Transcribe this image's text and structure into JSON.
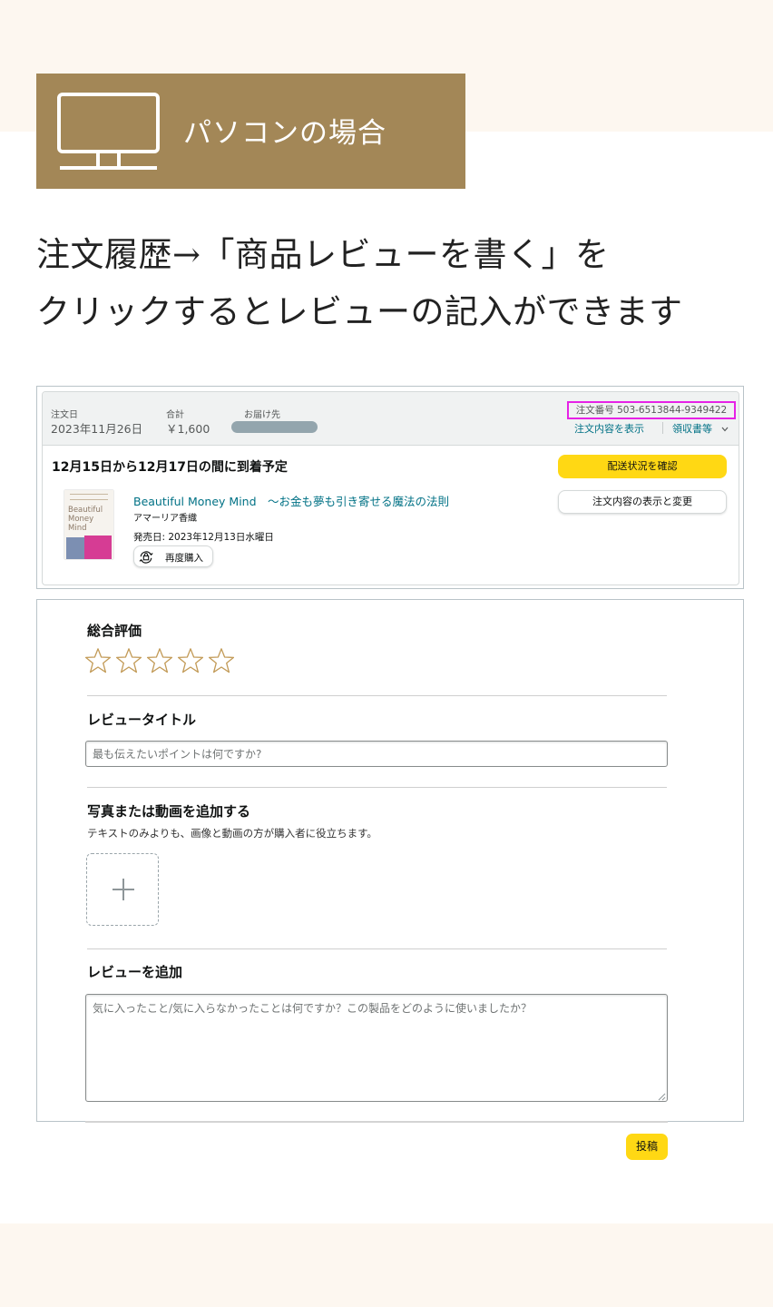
{
  "banner": {
    "label": "パソコンの場合"
  },
  "headline": {
    "line1": "注文履歴→「商品レビューを書く」を",
    "line2": "クリックするとレビューの記入ができます"
  },
  "order": {
    "date_label": "注文日",
    "date_value": "2023年11月26日",
    "total_label": "合計",
    "total_value": "￥1,600",
    "ship_label": "お届け先",
    "order_number": "注文番号 503-6513844-9349422",
    "view_details_link": "注文内容を表示",
    "receipt_link": "領収書等",
    "arrival": "12月15日から12月17日の間に到着予定",
    "track_button": "配送状況を確認",
    "change_button": "注文内容の表示と変更",
    "product_title": "Beautiful Money Mind　〜お金も夢も引き寄せる魔法の法則",
    "author": "アマーリア香織",
    "release": "発売日: 2023年12月13日水曜日",
    "rebuy_button": "再度購入",
    "book_cover_text": "Beautiful Money Mind"
  },
  "review": {
    "rating_label": "総合評価",
    "star_count": 5,
    "rating_value": 0,
    "title_label": "レビュータイトル",
    "title_placeholder": "最も伝えたいポイントは何ですか?",
    "media_label": "写真または動画を追加する",
    "media_help": "テキストのみよりも、画像と動画の方が購入者に役立ちます。",
    "body_label": "レビューを追加",
    "body_placeholder": "気に入ったこと/気に入らなかったことは何ですか？この製品をどのように使いましたか？",
    "submit_button": "投稿"
  },
  "colors": {
    "banner_bg": "#a38757",
    "highlight_box": "#e622e6",
    "primary_button": "#ffd814",
    "link": "#007185",
    "star_outline": "#c29a56"
  },
  "icons": [
    "monitor-icon",
    "chevron-down-icon",
    "rebuy-icon",
    "star-icon",
    "plus-icon",
    "resize-grip-icon"
  ]
}
